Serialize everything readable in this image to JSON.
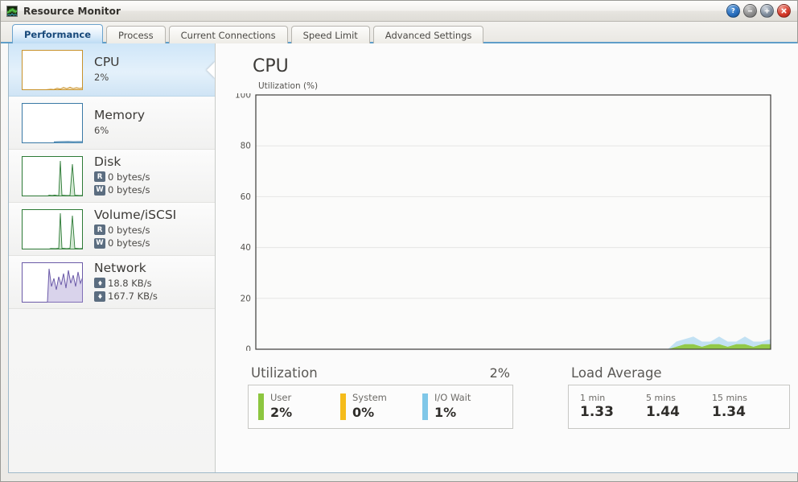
{
  "window": {
    "title": "Resource Monitor",
    "icon": "waveform-icon",
    "buttons": [
      {
        "name": "help-button",
        "glyph": "?",
        "color": "#2a6fbe"
      },
      {
        "name": "minimize-button",
        "glyph": "—",
        "color": "#8e8e8e"
      },
      {
        "name": "maximize-button",
        "glyph": "+",
        "color": "#7e8c9c"
      },
      {
        "name": "close-button",
        "glyph": "✕",
        "color": "#d63a2a"
      }
    ]
  },
  "tabs": [
    {
      "label": "Performance",
      "active": true
    },
    {
      "label": "Process",
      "active": false
    },
    {
      "label": "Current Connections",
      "active": false
    },
    {
      "label": "Speed Limit",
      "active": false
    },
    {
      "label": "Advanced Settings",
      "active": false
    }
  ],
  "sidebar": {
    "items": [
      {
        "name": "cpu",
        "title": "CPU",
        "selected": true,
        "color": "#c8922b",
        "fill": "rgba(214,163,64,0.35)",
        "lines": [
          {
            "badge": "",
            "text": "2%"
          }
        ]
      },
      {
        "name": "memory",
        "title": "Memory",
        "selected": false,
        "color": "#3a79a6",
        "fill": "rgba(110,170,205,0.35)",
        "lines": [
          {
            "badge": "",
            "text": "6%"
          }
        ]
      },
      {
        "name": "disk",
        "title": "Disk",
        "selected": false,
        "color": "#2d7a36",
        "fill": "rgba(110,180,110,0.35)",
        "lines": [
          {
            "badge": "R",
            "text": "0 bytes/s"
          },
          {
            "badge": "W",
            "text": "0 bytes/s"
          }
        ]
      },
      {
        "name": "volume-iscsi",
        "title": "Volume/iSCSI",
        "selected": false,
        "color": "#2d7a36",
        "fill": "rgba(110,180,110,0.35)",
        "lines": [
          {
            "badge": "R",
            "text": "0 bytes/s"
          },
          {
            "badge": "W",
            "text": "0 bytes/s"
          }
        ]
      },
      {
        "name": "network",
        "title": "Network",
        "selected": false,
        "color": "#6b5aa8",
        "fill": "rgba(160,145,205,0.40)",
        "lines": [
          {
            "badge": "up",
            "text": "18.8 KB/s"
          },
          {
            "badge": "down",
            "text": "167.7 KB/s"
          }
        ]
      }
    ]
  },
  "main": {
    "title": "CPU",
    "utilization": {
      "heading": "Utilization",
      "total": "2%",
      "legend": [
        {
          "name": "User",
          "value": "2%",
          "color": "#8cc63f"
        },
        {
          "name": "System",
          "value": "0%",
          "color": "#f5bc1b"
        },
        {
          "name": "I/O Wait",
          "value": "1%",
          "color": "#7fc7e8"
        }
      ]
    },
    "load_average": {
      "heading": "Load Average",
      "entries": [
        {
          "name": "1 min",
          "value": "1.33"
        },
        {
          "name": "5 mins",
          "value": "1.44"
        },
        {
          "name": "15 mins",
          "value": "1.34"
        }
      ]
    }
  },
  "chart_data": {
    "type": "area",
    "title": "CPU",
    "ylabel": "Utilization (%)",
    "xlabel": "",
    "ylim": [
      0,
      100
    ],
    "yticks": [
      0,
      20,
      40,
      60,
      80,
      100
    ],
    "ytick_labels": [
      "0",
      "20",
      "40",
      "60",
      "80",
      "100"
    ],
    "grid": "horizontal",
    "stacked": true,
    "legend_position": "below-chart",
    "x": [
      0,
      1,
      2,
      3,
      4,
      5,
      6,
      7,
      8,
      9,
      10,
      11,
      12,
      13,
      14,
      15,
      16,
      17,
      18,
      19,
      20,
      21,
      22,
      23,
      24,
      25,
      26,
      27,
      28,
      29,
      30,
      31,
      32,
      33,
      34,
      35,
      36,
      37,
      38,
      39,
      40,
      41,
      42,
      43,
      44,
      45,
      46,
      47,
      48,
      49,
      50,
      51,
      52,
      53,
      54,
      55,
      56,
      57,
      58,
      59,
      60
    ],
    "series": [
      {
        "name": "User",
        "color": "#8cc63f",
        "values": [
          0,
          0,
          0,
          0,
          0,
          0,
          0,
          0,
          0,
          0,
          0,
          0,
          0,
          0,
          0,
          0,
          0,
          0,
          0,
          0,
          0,
          0,
          0,
          0,
          0,
          0,
          0,
          0,
          0,
          0,
          0,
          0,
          0,
          0,
          0,
          0,
          0,
          0,
          0,
          0,
          0,
          0,
          0,
          0,
          0,
          0,
          0,
          0,
          0,
          1,
          2,
          2,
          1,
          2,
          2,
          1,
          2,
          2,
          1,
          2,
          2
        ]
      },
      {
        "name": "System",
        "color": "#f5bc1b",
        "values": [
          0,
          0,
          0,
          0,
          0,
          0,
          0,
          0,
          0,
          0,
          0,
          0,
          0,
          0,
          0,
          0,
          0,
          0,
          0,
          0,
          0,
          0,
          0,
          0,
          0,
          0,
          0,
          0,
          0,
          0,
          0,
          0,
          0,
          0,
          0,
          0,
          0,
          0,
          0,
          0,
          0,
          0,
          0,
          0,
          0,
          0,
          0,
          0,
          0,
          0,
          0,
          0,
          0,
          0,
          0,
          0,
          0,
          0,
          0,
          0,
          0
        ]
      },
      {
        "name": "I/O Wait",
        "color": "#bfdff2",
        "values": [
          0,
          0,
          0,
          0,
          0,
          0,
          0,
          0,
          0,
          0,
          0,
          0,
          0,
          0,
          0,
          0,
          0,
          0,
          0,
          0,
          0,
          0,
          0,
          0,
          0,
          0,
          0,
          0,
          0,
          0,
          0,
          0,
          0,
          0,
          0,
          0,
          0,
          0,
          0,
          0,
          0,
          0,
          0,
          0,
          0,
          0,
          0,
          0,
          0,
          2,
          2,
          3,
          2,
          1,
          3,
          2,
          1,
          3,
          2,
          1,
          2
        ]
      }
    ]
  }
}
